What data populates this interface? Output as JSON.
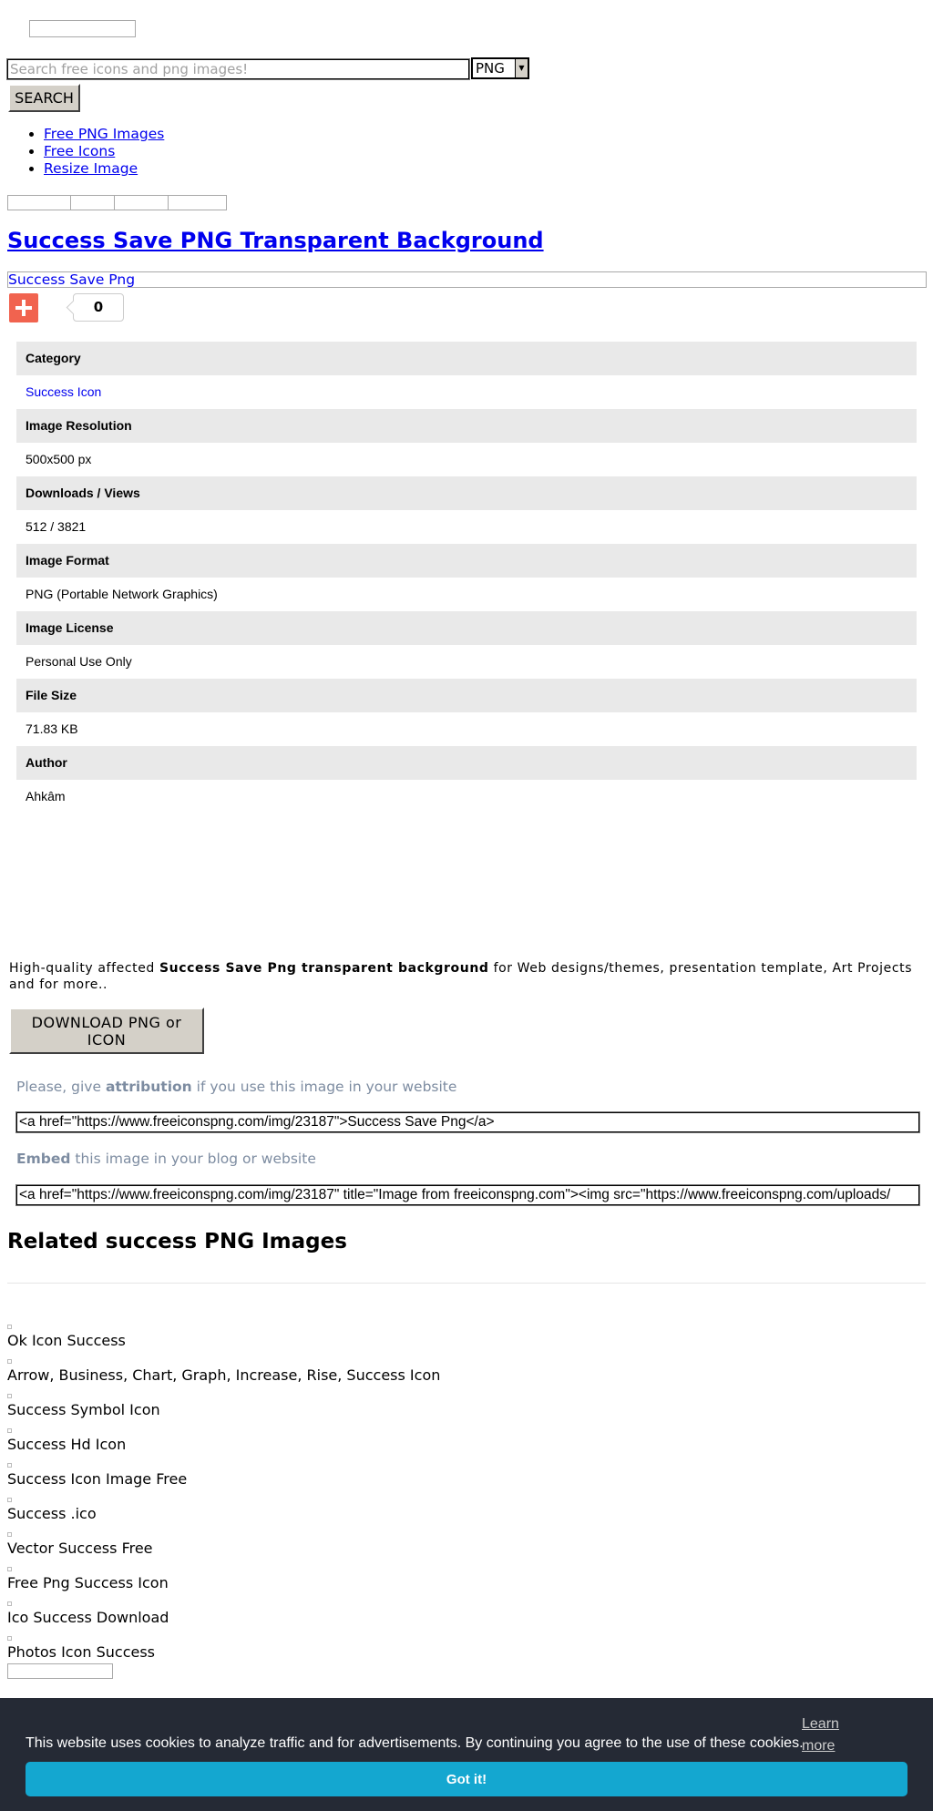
{
  "search": {
    "placeholder": "Search free icons and png images!",
    "format_value": "PNG",
    "button_label": "SEARCH"
  },
  "nav": {
    "items": [
      {
        "label": "Free PNG Images"
      },
      {
        "label": "Free Icons"
      },
      {
        "label": "Resize Image"
      }
    ]
  },
  "page": {
    "title": "Success Save PNG Transparent Background",
    "subtitle_link": "Success Save Png",
    "share_count": "0"
  },
  "info": {
    "category_label": "Category",
    "category_value": "Success Icon",
    "resolution_label": "Image Resolution",
    "resolution_value": "500x500 px",
    "downloads_label": "Downloads",
    "views_label": "Views",
    "stats_value": "512 / 3821",
    "format_label": "Image Format",
    "format_value": "PNG (Portable Network Graphics)",
    "license_label": "Image License",
    "license_value": "Personal Use Only",
    "size_label": "File Size",
    "size_value": "71.83 KB",
    "author_label": "Author",
    "author_value": "Ahkâm"
  },
  "description": {
    "prefix": "High-quality affected ",
    "bold": "Success Save Png transparent background",
    "suffix": " for Web designs/themes, presentation template, Art Projects and for more.."
  },
  "download_label": "DOWNLOAD PNG or ICON",
  "attribution": {
    "pre": "Please, give ",
    "bold": "attribution",
    "post": " if you use this image in your website",
    "code": "<a href=\"https://www.freeiconspng.com/img/23187\">Success Save Png</a>"
  },
  "embed": {
    "bold": "Embed",
    "post": " this image in your blog or website",
    "code": "<a href=\"https://www.freeiconspng.com/img/23187\" title=\"Image from freeiconspng.com\"><img src=\"https://www.freeiconspng.com/uploads/"
  },
  "related": {
    "title": "Related success PNG Images",
    "items": [
      {
        "label": "Ok Icon Success"
      },
      {
        "label": "Arrow, Business, Chart, Graph, Increase, Rise, Success Icon"
      },
      {
        "label": "Success Symbol Icon"
      },
      {
        "label": "Success Hd Icon"
      },
      {
        "label": "Success Icon Image Free"
      },
      {
        "label": "Success .ico"
      },
      {
        "label": "Vector Success Free"
      },
      {
        "label": "Free Png Success Icon"
      },
      {
        "label": "Ico Success Download"
      },
      {
        "label": "Photos Icon Success"
      }
    ]
  },
  "cookie": {
    "message": "This website uses cookies to analyze traffic and for advertisements. By continuing you agree to the use of these cookies.",
    "learn_more": "Learn more",
    "button": "Got it!"
  },
  "colors": {
    "plus_button": "#f1634f",
    "cookie_bar": "#252a35",
    "cookie_button": "#14a7d0",
    "attribution_text": "#7d8ca1",
    "info_header_bg": "#e9e9e9"
  },
  "icons": {
    "share_plus": "plus-icon",
    "select_arrow": "chevron-down-icon"
  }
}
